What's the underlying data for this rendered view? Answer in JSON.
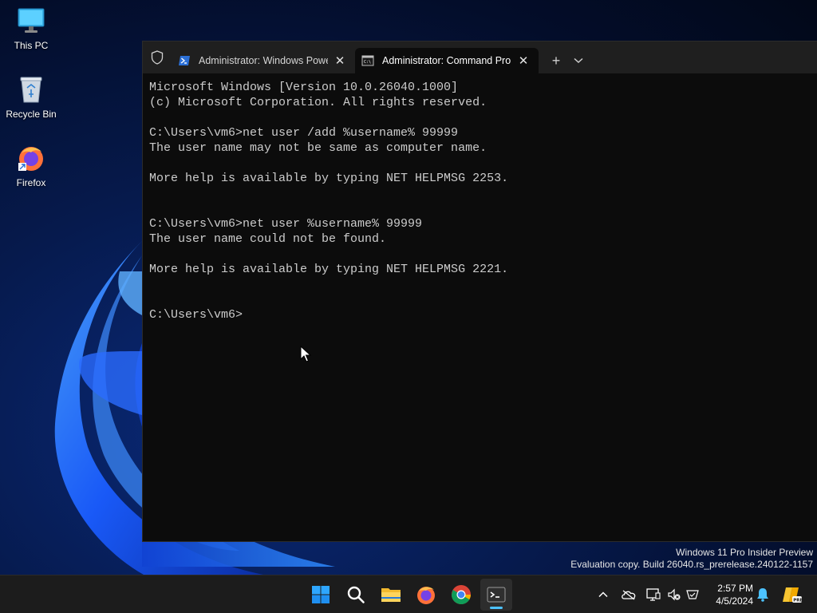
{
  "desktop": {
    "icons": [
      {
        "label": "This PC",
        "icon": "this-pc-icon"
      },
      {
        "label": "Recycle Bin",
        "icon": "recycle-bin-icon"
      },
      {
        "label": "Firefox",
        "icon": "firefox-icon"
      }
    ]
  },
  "terminal": {
    "tabs": [
      {
        "title": "Administrator: Windows Powe",
        "icon": "powershell-icon",
        "active": false
      },
      {
        "title": "Administrator: Command Pro",
        "icon": "cmd-icon",
        "active": true
      }
    ],
    "close_glyph": "✕",
    "new_tab_glyph": "+",
    "dropdown_glyph": "⌄",
    "lines": [
      "Microsoft Windows [Version 10.0.26040.1000]",
      "(c) Microsoft Corporation. All rights reserved.",
      "",
      "C:\\Users\\vm6>net user /add %username% 99999",
      "The user name may not be same as computer name.",
      "",
      "More help is available by typing NET HELPMSG 2253.",
      "",
      "",
      "C:\\Users\\vm6>net user %username% 99999",
      "The user name could not be found.",
      "",
      "More help is available by typing NET HELPMSG 2221.",
      "",
      "",
      "C:\\Users\\vm6>"
    ]
  },
  "watermark": {
    "line1": "Windows 11 Pro Insider Preview",
    "line2": "Evaluation copy. Build 26040.rs_prerelease.240122-1157"
  },
  "taskbar": {
    "apps": [
      "start-icon",
      "search-icon",
      "file-explorer-icon",
      "firefox-icon",
      "chrome-icon",
      "terminal-icon"
    ],
    "active_app": "terminal-icon",
    "tray": [
      "chevron-up-icon",
      "onedrive-icon",
      "display-icon",
      "volume-muted-icon",
      "network-icon"
    ],
    "clock": {
      "time": "2:57 PM",
      "date": "4/5/2024"
    },
    "accent": "#4cc2ff"
  }
}
